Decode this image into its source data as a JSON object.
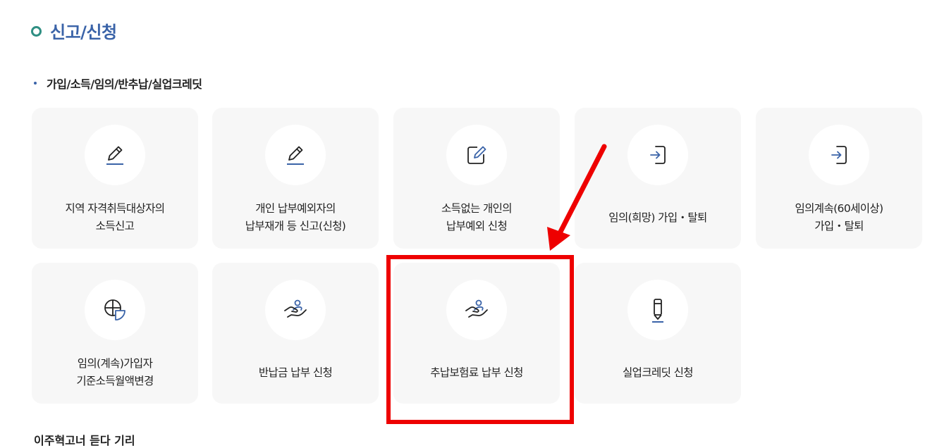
{
  "section": {
    "title": "신고/신청"
  },
  "subsection": {
    "title": "가입/소득/임의/반추납/실업크레딧"
  },
  "cards": [
    {
      "icon": "pencil-icon",
      "lines": [
        "지역 자격취득대상자의",
        "소득신고"
      ]
    },
    {
      "icon": "pencil-icon",
      "lines": [
        "개인 납부예외자의",
        "납부재개 등 신고(신청)"
      ]
    },
    {
      "icon": "edit-square-icon",
      "lines": [
        "소득없는 개인의",
        "납부예외 신청"
      ]
    },
    {
      "icon": "login-icon",
      "lines": [
        "임의(희망) 가입・탈퇴"
      ]
    },
    {
      "icon": "login-icon",
      "lines": [
        "임의계속(60세이상)",
        "가입・탈퇴"
      ]
    },
    {
      "icon": "chart-icon",
      "lines": [
        "임의(계속)가입자",
        "기준소득월액변경"
      ]
    },
    {
      "icon": "hand-person-icon",
      "lines": [
        "반납금 납부 신청"
      ]
    },
    {
      "icon": "hand-person-icon",
      "lines": [
        "추납보험료 납부 신청"
      ]
    },
    {
      "icon": "pen-icon",
      "lines": [
        "실업크레딧 신청"
      ]
    }
  ],
  "next_section": {
    "title": "이주혁고너 듣다 기리"
  },
  "annotation": {
    "highlight_color": "#ee0000"
  },
  "colors": {
    "accent": "#3a63a8",
    "card_bg": "#f7f7f7",
    "ring": "#2f8f83"
  }
}
